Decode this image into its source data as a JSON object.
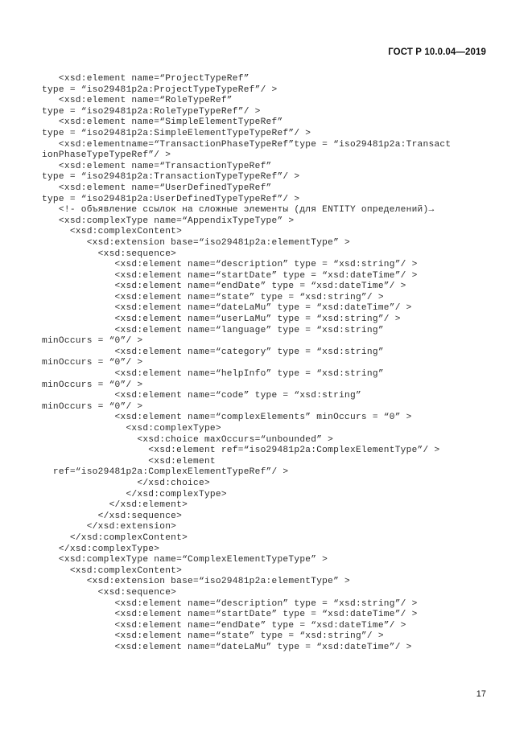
{
  "document": {
    "standard_header": "ГОСТ Р 10.0.04—2019",
    "page_number": "17",
    "language": "ru"
  },
  "code": {
    "language": "xsd",
    "lines": [
      "   <xsd:element name=“ProjectTypeRef”",
      "type = “iso29481p2a:ProjectTypeTypeRef”/ >",
      "   <xsd:element name=“RoleTypeRef”",
      "type = “iso29481p2a:RoleTypeTypeRef”/ >",
      "   <xsd:element name=“SimpleElementTypeRef”",
      "type = “iso29481p2a:SimpleElementTypeTypeRef”/ >",
      "   <xsd:elementname=“TransactionPhaseTypeRef”type = “iso29481p2a:Transact",
      "ionPhaseTypeTypeRef”/ >",
      "   <xsd:element name=“TransactionTypeRef”",
      "type = “iso29481p2a:TransactionTypeTypeRef”/ >",
      "   <xsd:element name=“UserDefinedTypeRef”",
      "type = “iso29481p2a:UserDefinedTypeTypeRef”/ >",
      "   <!- объявление ссылок на сложные элементы (для ENTITY определений)→",
      "   <xsd:complexType name=“AppendixTypeType” >",
      "     <xsd:complexContent>",
      "        <xsd:extension base=“iso29481p2a:elementType” >",
      "          <xsd:sequence>",
      "             <xsd:element name=“description” type = “xsd:string”/ >",
      "             <xsd:element name=“startDate” type = “xsd:dateTime”/ >",
      "             <xsd:element name=“endDate” type = “xsd:dateTime”/ >",
      "             <xsd:element name=“state” type = “xsd:string”/ >",
      "             <xsd:element name=“dateLaMu” type = “xsd:dateTime”/ >",
      "             <xsd:element name=“userLaMu” type = “xsd:string”/ >",
      "             <xsd:element name=“language” type = “xsd:string”",
      "minOccurs = “0”/ >",
      "             <xsd:element name=“category” type = “xsd:string”",
      "minOccurs = “0”/ >",
      "             <xsd:element name=“helpInfo” type = “xsd:string”",
      "minOccurs = “0”/ >",
      "             <xsd:element name=“code” type = “xsd:string”",
      "minOccurs = “0”/ >",
      "             <xsd:element name=“complexElements” minOccurs = “0” >",
      "               <xsd:complexType>",
      "                 <xsd:choice maxOccurs=“unbounded” >",
      "                   <xsd:element ref=“iso29481p2a:ComplexElementType”/ >",
      "                   <xsd:element",
      "  ref=“iso29481p2a:ComplexElementTypeRef”/ >",
      "                 </xsd:choice>",
      "               </xsd:complexType>",
      "            </xsd:element>",
      "          </xsd:sequence>",
      "        </xsd:extension>",
      "     </xsd:complexContent>",
      "   </xsd:complexType>",
      "   <xsd:complexType name=“ComplexElementTypeType” >",
      "     <xsd:complexContent>",
      "        <xsd:extension base=“iso29481p2a:elementType” >",
      "          <xsd:sequence>",
      "             <xsd:element name=“description” type = “xsd:string”/ >",
      "             <xsd:element name=“startDate” type = “xsd:dateTime”/ >",
      "             <xsd:element name=“endDate” type = “xsd:dateTime”/ >",
      "             <xsd:element name=“state” type = “xsd:string”/ >",
      "             <xsd:element name=“dateLaMu” type = “xsd:dateTime”/ >"
    ]
  }
}
